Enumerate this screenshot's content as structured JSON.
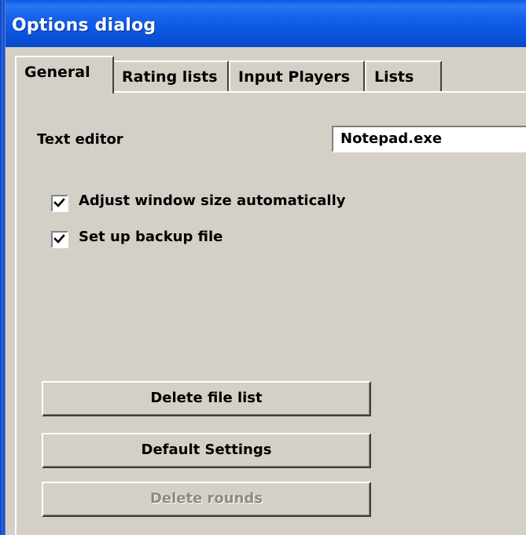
{
  "window": {
    "title": "Options dialog"
  },
  "tabs": [
    {
      "label": "General",
      "active": true
    },
    {
      "label": "Rating lists",
      "active": false
    },
    {
      "label": "Input Players",
      "active": false
    },
    {
      "label": "Lists",
      "active": false
    }
  ],
  "general": {
    "text_editor_label": "Text editor",
    "text_editor_value": "Notepad.exe",
    "checkboxes": [
      {
        "label": "Adjust window size automatically",
        "checked": true
      },
      {
        "label": "Set up backup file",
        "checked": true
      }
    ],
    "buttons": {
      "delete_file_list": "Delete file list",
      "default_settings": "Default Settings",
      "delete_rounds": "Delete rounds"
    }
  },
  "colors": {
    "titlebar": "#0a54e0",
    "face": "#d4d0c8",
    "disabled_text": "#8c8a85"
  }
}
